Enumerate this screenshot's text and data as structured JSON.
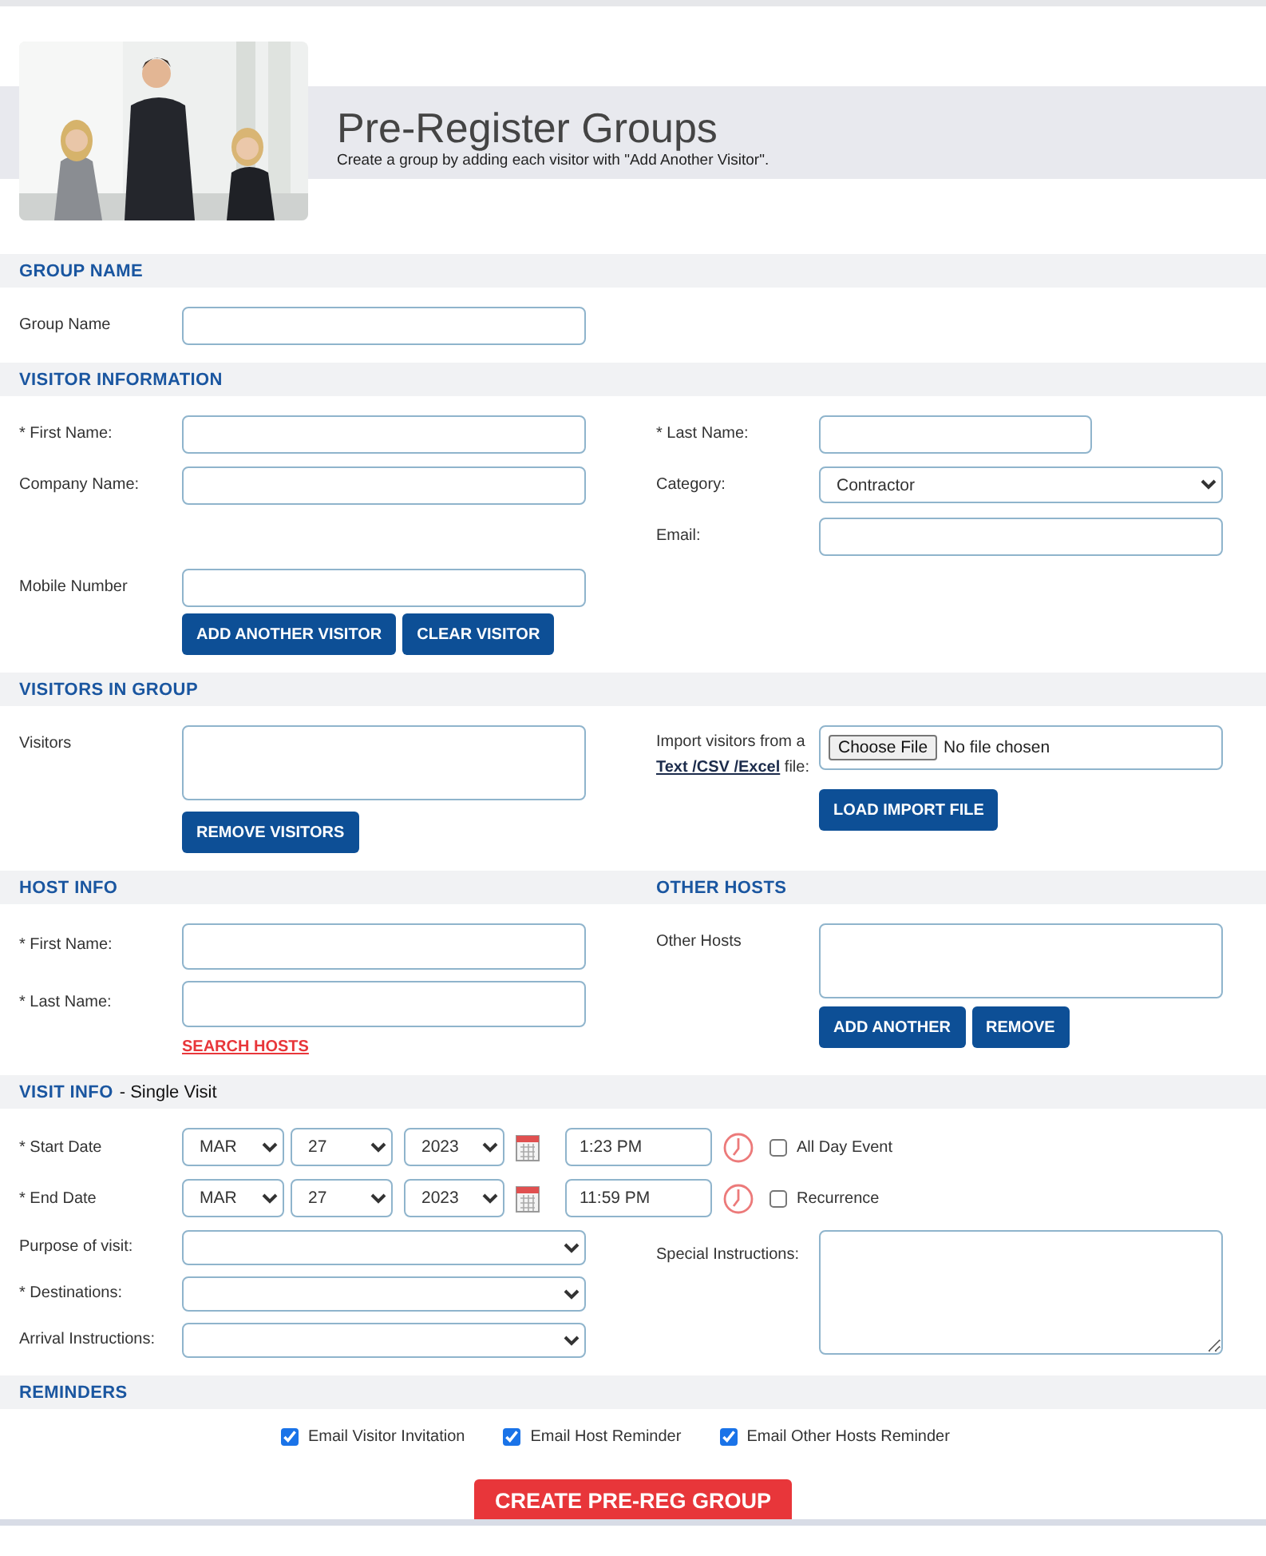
{
  "header": {
    "title": "Pre-Register Groups",
    "subtitle": "Create a group by adding each visitor with \"Add Another Visitor\"."
  },
  "sections": [
    {
      "headings": [
        {
          "title": "GROUP NAME"
        }
      ],
      "blocks": [
        {
          "kind": "row",
          "left": {
            "kind": "text",
            "label": "Group Name"
          }
        }
      ]
    },
    {
      "headings": [
        {
          "title": "VISITOR INFORMATION"
        }
      ],
      "blocks": [
        {
          "kind": "row",
          "left": {
            "kind": "text",
            "label": "* First Name:"
          },
          "right": {
            "kind": "short_text",
            "label": "* Last Name:"
          }
        },
        {
          "kind": "row",
          "left": {
            "kind": "text",
            "label": "Company Name:"
          },
          "right": {
            "kind": "select",
            "label": "Category:",
            "value": "Contractor"
          }
        },
        {
          "kind": "row",
          "right": {
            "kind": "text",
            "label": "Email:"
          }
        },
        {
          "kind": "row",
          "left": {
            "kind": "text",
            "label": "Mobile Number"
          }
        },
        {
          "kind": "row",
          "left": {
            "kind": "buttons",
            "buttons": [
              "ADD ANOTHER VISITOR",
              "CLEAR VISITOR"
            ]
          }
        }
      ]
    },
    {
      "headings": [
        {
          "title": "VISITORS IN GROUP"
        }
      ],
      "blocks": [
        {
          "kind": "columns",
          "left": [
            {
              "kind": "list",
              "label": "Visitors"
            },
            {
              "kind": "buttons",
              "buttons": [
                "REMOVE VISITORS"
              ]
            }
          ],
          "right": [
            {
              "kind": "file",
              "label": "Import visitors from a",
              "link": "Text /CSV /Excel",
              "label_after": "file:",
              "button": "Choose File",
              "status": "No file chosen"
            },
            {
              "kind": "buttons",
              "buttons": [
                "LOAD IMPORT FILE"
              ]
            }
          ]
        }
      ]
    },
    {
      "headings": [
        {
          "title": "HOST INFO"
        },
        {
          "title": "OTHER HOSTS"
        }
      ],
      "blocks": [
        {
          "kind": "columns",
          "left": [
            {
              "kind": "tall_text",
              "label": "* First Name:"
            },
            {
              "kind": "tall_text",
              "label": "* Last Name:"
            },
            {
              "kind": "link",
              "text": "SEARCH HOSTS"
            }
          ],
          "right": [
            {
              "kind": "list",
              "label": "Other Hosts"
            },
            {
              "kind": "buttons",
              "buttons": [
                "ADD ANOTHER",
                "REMOVE"
              ]
            }
          ]
        }
      ]
    },
    {
      "headings": [
        {
          "title": "VISIT INFO",
          "note": "- Single Visit"
        }
      ],
      "blocks": [
        {
          "kind": "datetime",
          "label": "* Start Date",
          "month": "MAR",
          "day": "27",
          "year": "2023",
          "time": "1:23 PM",
          "option": {
            "label": "All Day Event",
            "checked": false
          }
        },
        {
          "kind": "datetime",
          "label": "* End Date",
          "month": "MAR",
          "day": "27",
          "year": "2023",
          "time": "11:59 PM",
          "option": {
            "label": "Recurrence",
            "checked": false
          }
        },
        {
          "kind": "columns",
          "left": [
            {
              "kind": "small_select",
              "label": "Purpose of visit:"
            },
            {
              "kind": "small_select",
              "label": "* Destinations:"
            },
            {
              "kind": "small_select",
              "label": "Arrival Instructions:"
            }
          ],
          "right": [
            {
              "kind": "textarea",
              "label": "Special Instructions:"
            }
          ]
        }
      ]
    },
    {
      "headings": [
        {
          "title": "REMINDERS"
        }
      ],
      "blocks": [
        {
          "kind": "checks",
          "items": [
            {
              "label": "Email Visitor Invitation",
              "checked": true
            },
            {
              "label": "Email Host Reminder",
              "checked": true
            },
            {
              "label": "Email Other Hosts Reminder",
              "checked": true
            }
          ]
        }
      ]
    }
  ],
  "submit": {
    "label": "CREATE PRE-REG GROUP"
  }
}
